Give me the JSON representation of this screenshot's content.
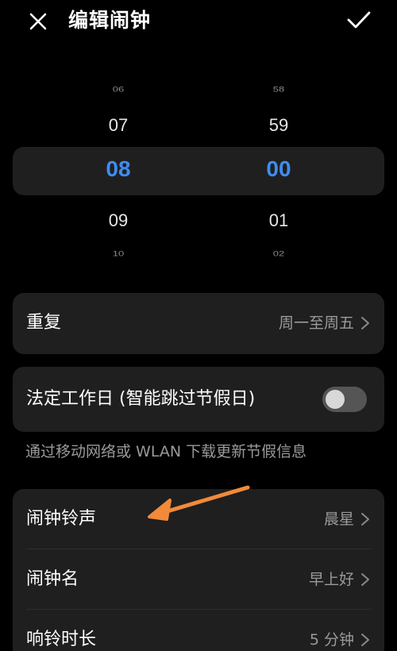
{
  "header": {
    "title": "编辑闹钟",
    "close_icon": "close-icon",
    "confirm_icon": "check-icon"
  },
  "time_picker": {
    "hours": [
      "06",
      "07",
      "08",
      "09",
      "10"
    ],
    "minutes": [
      "58",
      "59",
      "00",
      "01",
      "02"
    ],
    "selected_hour": "08",
    "selected_minute": "00"
  },
  "repeat": {
    "label": "重复",
    "value": "周一至周五"
  },
  "workday": {
    "label": "法定工作日 (智能跳过节假日)",
    "enabled": false
  },
  "hint_text": "通过移动网络或 WLAN 下载更新节假信息",
  "settings": [
    {
      "label": "闹钟铃声",
      "value": "晨星"
    },
    {
      "label": "闹钟名",
      "value": "早上好"
    },
    {
      "label": "响铃时长",
      "value": "5 分钟"
    }
  ],
  "colors": {
    "accent": "#3f8cf0",
    "annotation_arrow": "#f28a3a",
    "card_bg": "#1f1f1f"
  }
}
